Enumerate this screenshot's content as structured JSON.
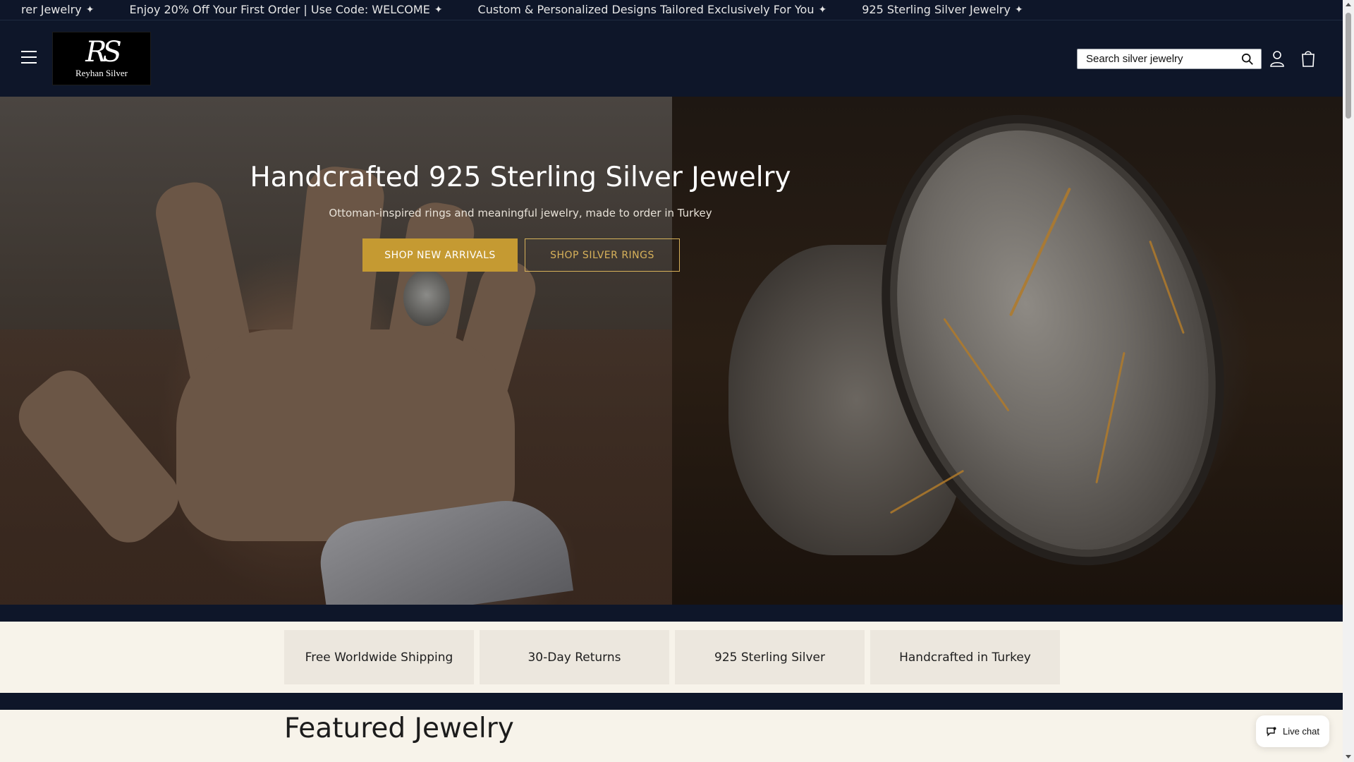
{
  "announcement": {
    "messages": [
      "rer Jewelry",
      "Enjoy 20% Off Your First Order | Use Code: WELCOME",
      "Custom & Personalized Designs Tailored Exclusively For You",
      "925 Sterling Silver Jewelry"
    ],
    "separator": "✦"
  },
  "header": {
    "logo_monogram": "RS",
    "logo_name": "Reyhan Silver",
    "search_placeholder": "Search silver jewelry",
    "icons": [
      "menu-icon",
      "search-icon",
      "account-icon",
      "cart-icon"
    ]
  },
  "hero": {
    "title": "Handcrafted 925 Sterling Silver Jewelry",
    "subtitle": "Ottoman-inspired rings and meaningful jewelry, made to order in Turkey",
    "primary_button": "SHOP NEW ARRIVALS",
    "secondary_button": "SHOP SILVER RINGS"
  },
  "features": [
    "Free Worldwide Shipping",
    "30-Day Returns",
    "925 Sterling Silver",
    "Handcrafted in Turkey"
  ],
  "featured": {
    "title": "Featured Jewelry"
  },
  "live_chat": {
    "label": "Live chat"
  },
  "colors": {
    "navy": "#0e1629",
    "gold": "#c59a32",
    "cream": "#f7f3ea",
    "feature_bg": "#ece7de"
  }
}
